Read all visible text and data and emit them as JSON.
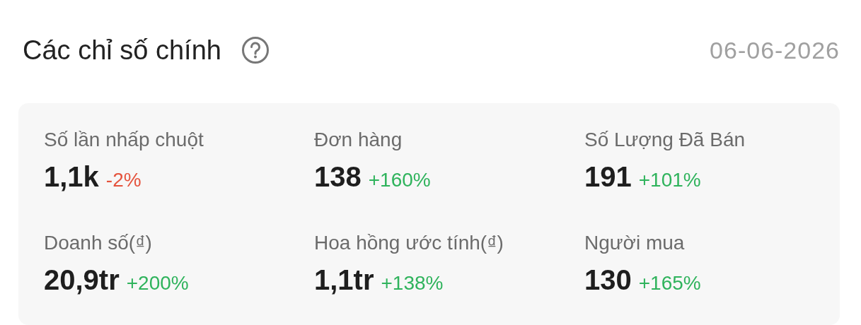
{
  "header": {
    "title": "Các chỉ số chính",
    "date": "06-06-2026"
  },
  "metrics": [
    {
      "label": "Số lần nhấp chuột",
      "value": "1,1k",
      "change": "-2%",
      "color": "#e5533d"
    },
    {
      "label": "Đơn hàng",
      "value": "138",
      "change": "+160%",
      "color": "#2fb35c"
    },
    {
      "label": "Số Lượng Đã Bán",
      "value": "191",
      "change": "+101%",
      "color": "#2fb35c"
    },
    {
      "label": "Doanh số(₫)",
      "value": "20,9tr",
      "change": "+200%",
      "color": "#2fb35c"
    },
    {
      "label": "Hoa hồng ước tính(₫)",
      "value": "1,1tr",
      "change": "+138%",
      "color": "#2fb35c"
    },
    {
      "label": "Người mua",
      "value": "130",
      "change": "+165%",
      "color": "#2fb35c"
    }
  ]
}
